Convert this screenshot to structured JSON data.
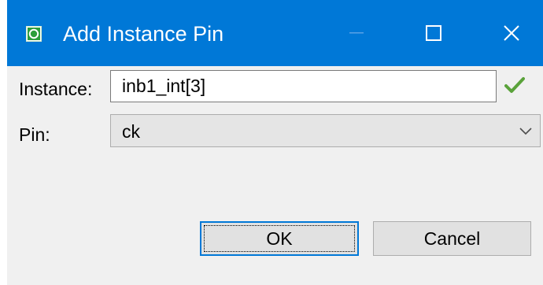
{
  "window": {
    "title": "Add Instance Pin",
    "titlebar_color": "#0078d7",
    "icons": [
      "app-icon",
      "minimize-icon",
      "maximize-icon",
      "close-icon"
    ]
  },
  "form": {
    "instance_label": "Instance:",
    "instance_value": "inb1_int[3]",
    "instance_valid_icon": "checkmark-icon",
    "pin_label": "Pin:",
    "pin_value": "ck"
  },
  "buttons": {
    "ok": "OK",
    "cancel": "Cancel"
  }
}
